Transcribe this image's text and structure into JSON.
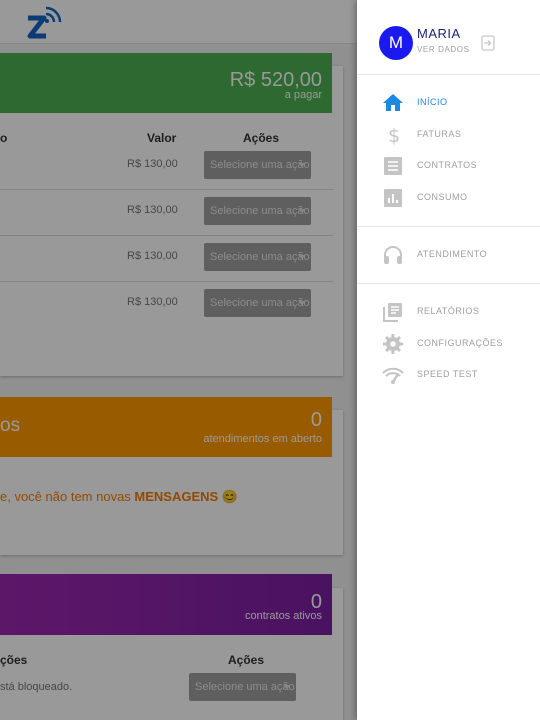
{
  "background": {
    "billing": {
      "amount": "R$ 520,00",
      "amount_label": "a pagar",
      "headers": {
        "left": "o",
        "value": "Valor",
        "actions": "Ações"
      },
      "rows": [
        {
          "value": "R$ 130,00",
          "action": "Selecione uma ação"
        },
        {
          "value": "R$ 130,00",
          "action": "Selecione uma ação"
        },
        {
          "value": "R$ 130,00",
          "action": "Selecione uma ação"
        },
        {
          "value": "R$ 130,00",
          "action": "Selecione uma ação"
        }
      ]
    },
    "tickets": {
      "title_fragment": "os",
      "count": "0",
      "count_label": "atendimentos em aberto",
      "message_prefix": "e, você não tem novas ",
      "message_bold": "MENSAGENS",
      "message_emoji": "😊"
    },
    "contracts": {
      "count": "0",
      "count_label": "contratos ativos",
      "headers": {
        "left": "ções",
        "actions": "Ações"
      },
      "row_text": "stá bloqueado.",
      "row_action": "Selecione uma ação"
    }
  },
  "drawer": {
    "user": {
      "initial": "M",
      "name": "MARIA",
      "sub": "VER DADOS"
    },
    "items": [
      {
        "label": "INÍCIO",
        "icon": "home-icon",
        "active": true
      },
      {
        "label": "FATURAS",
        "icon": "dollar-icon",
        "active": false
      },
      {
        "label": "CONTRATOS",
        "icon": "document-icon",
        "active": false
      },
      {
        "label": "CONSUMO",
        "icon": "bar-chart-icon",
        "active": false
      },
      {
        "label": "ATENDIMENTO",
        "icon": "headset-icon",
        "active": false
      },
      {
        "label": "RELATÓRIOS",
        "icon": "library-icon",
        "active": false
      },
      {
        "label": "CONFIGURAÇÕES",
        "icon": "gear-icon",
        "active": false
      },
      {
        "label": "SPEED TEST",
        "icon": "speed-test-icon",
        "active": false
      }
    ]
  },
  "colors": {
    "accent": "#1e88e5",
    "avatar": "#1a1af0",
    "green": "#4caf50",
    "orange": "#ff9800",
    "purple": "#8e24aa"
  }
}
